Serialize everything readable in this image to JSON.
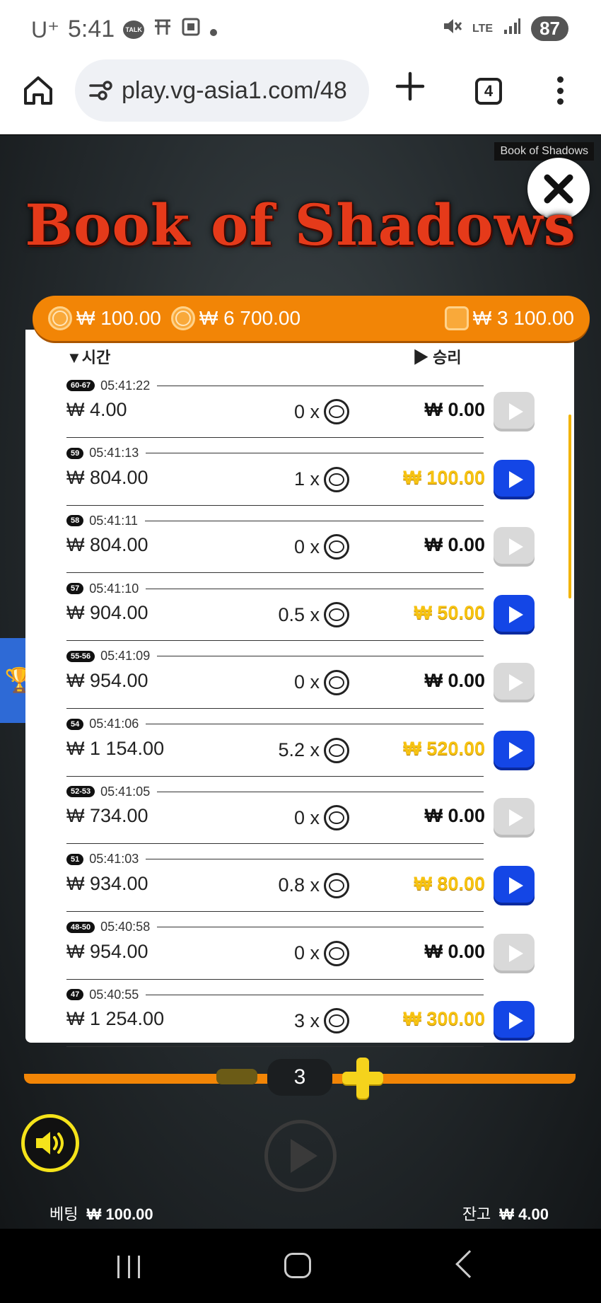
{
  "status_bar": {
    "carrier": "U⁺",
    "time": "5:41",
    "talk_badge": "TALK",
    "network": "LTE",
    "battery": "87"
  },
  "browser": {
    "url": "play.vg-asia1.com/48",
    "tab_count": "4"
  },
  "game": {
    "frame_label": "Book of Shadows",
    "title": "Book of Shadows",
    "summary": {
      "bet": "₩ 100.00",
      "max_win": "₩ 6 700.00",
      "wallet": "₩ 3 100.00"
    },
    "list_headers": {
      "time": "시간",
      "win": "승리"
    },
    "rounds": [
      {
        "id": "60-67",
        "time": "05:41:22",
        "bet": "₩ 4.00",
        "multiplier": "0 x",
        "win": "₩ 0.00",
        "won": false
      },
      {
        "id": "59",
        "time": "05:41:13",
        "bet": "₩ 804.00",
        "multiplier": "1 x",
        "win": "₩ 100.00",
        "won": true
      },
      {
        "id": "58",
        "time": "05:41:11",
        "bet": "₩ 804.00",
        "multiplier": "0 x",
        "win": "₩ 0.00",
        "won": false
      },
      {
        "id": "57",
        "time": "05:41:10",
        "bet": "₩ 904.00",
        "multiplier": "0.5 x",
        "win": "₩ 50.00",
        "won": true
      },
      {
        "id": "55-56",
        "time": "05:41:09",
        "bet": "₩ 954.00",
        "multiplier": "0 x",
        "win": "₩ 0.00",
        "won": false
      },
      {
        "id": "54",
        "time": "05:41:06",
        "bet": "₩ 1 154.00",
        "multiplier": "5.2 x",
        "win": "₩ 520.00",
        "won": true
      },
      {
        "id": "52-53",
        "time": "05:41:05",
        "bet": "₩ 734.00",
        "multiplier": "0 x",
        "win": "₩ 0.00",
        "won": false
      },
      {
        "id": "51",
        "time": "05:41:03",
        "bet": "₩ 934.00",
        "multiplier": "0.8 x",
        "win": "₩ 80.00",
        "won": true
      },
      {
        "id": "48-50",
        "time": "05:40:58",
        "bet": "₩ 954.00",
        "multiplier": "0 x",
        "win": "₩ 0.00",
        "won": false
      },
      {
        "id": "47",
        "time": "05:40:55",
        "bet": "₩ 1 254.00",
        "multiplier": "3 x",
        "win": "₩ 300.00",
        "won": true
      }
    ],
    "stepper_value": "3",
    "bet_label": "베팅",
    "bet_value": "₩ 100.00",
    "balance_label": "잔고",
    "balance_value": "₩ 4.00",
    "colors": {
      "accent_orange": "#f28506",
      "win_gold": "#f7c311",
      "play_blue": "#1446e6",
      "title_red": "#e53a1a"
    }
  }
}
